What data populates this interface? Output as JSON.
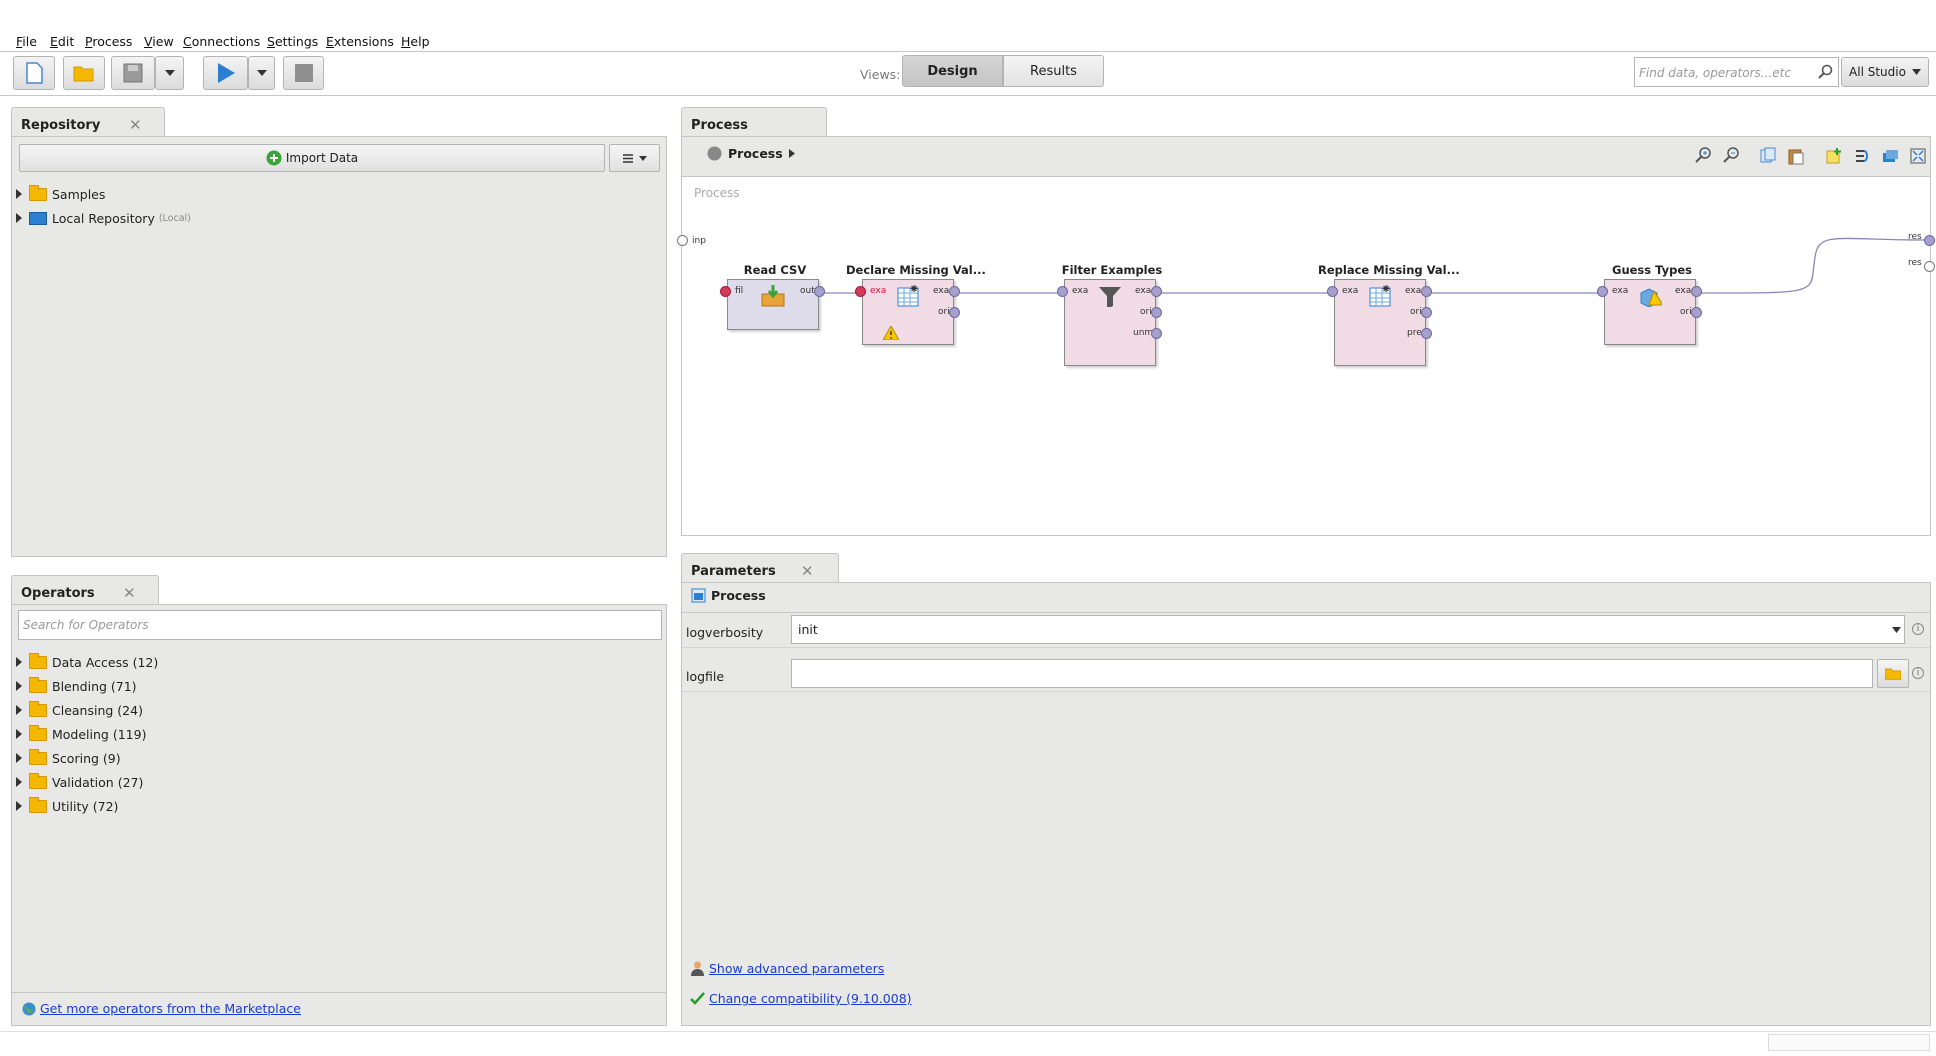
{
  "menu": [
    "File",
    "Edit",
    "Process",
    "View",
    "Connections",
    "Settings",
    "Extensions",
    "Help"
  ],
  "toolbar": {
    "views_label": "Views:",
    "design_label": "Design",
    "results_label": "Results",
    "search_placeholder": "Find data, operators...etc",
    "studio_label": "All Studio"
  },
  "repository": {
    "tab_label": "Repository",
    "import_label": "Import Data",
    "items": [
      {
        "label": "Samples",
        "suffix": ""
      },
      {
        "label": "Local Repository",
        "suffix": "(Local)"
      }
    ]
  },
  "operators": {
    "tab_label": "Operators",
    "search_placeholder": "Search for Operators",
    "items": [
      "Data Access (12)",
      "Blending (71)",
      "Cleansing (24)",
      "Modeling (119)",
      "Scoring (9)",
      "Validation (27)",
      "Utility (72)"
    ],
    "marketplace_link": "Get more operators from the Marketplace"
  },
  "process": {
    "tab_label": "Process",
    "breadcrumb": "Process",
    "canvas_label": "Process",
    "inp_label": "inp",
    "res_labels": [
      "res",
      "res"
    ],
    "operators": [
      {
        "title": "Read CSV",
        "in_ports": [
          "fil"
        ],
        "out_ports": [
          "out"
        ]
      },
      {
        "title": "Declare Missing Val...",
        "in_ports": [
          "exa"
        ],
        "out_ports": [
          "exa",
          "ori"
        ]
      },
      {
        "title": "Filter Examples",
        "in_ports": [
          "exa"
        ],
        "out_ports": [
          "exa",
          "ori",
          "unm"
        ]
      },
      {
        "title": "Replace Missing Val...",
        "in_ports": [
          "exa"
        ],
        "out_ports": [
          "exa",
          "ori",
          "pre"
        ]
      },
      {
        "title": "Guess Types",
        "in_ports": [
          "exa"
        ],
        "out_ports": [
          "exa",
          "ori"
        ]
      }
    ]
  },
  "parameters": {
    "tab_label": "Parameters",
    "heading": "Process",
    "rows": [
      {
        "label": "logverbosity",
        "value": "init"
      },
      {
        "label": "logfile",
        "value": ""
      }
    ],
    "advanced_link": "Show advanced parameters",
    "compat_link": "Change compatibility (9.10.008)"
  }
}
